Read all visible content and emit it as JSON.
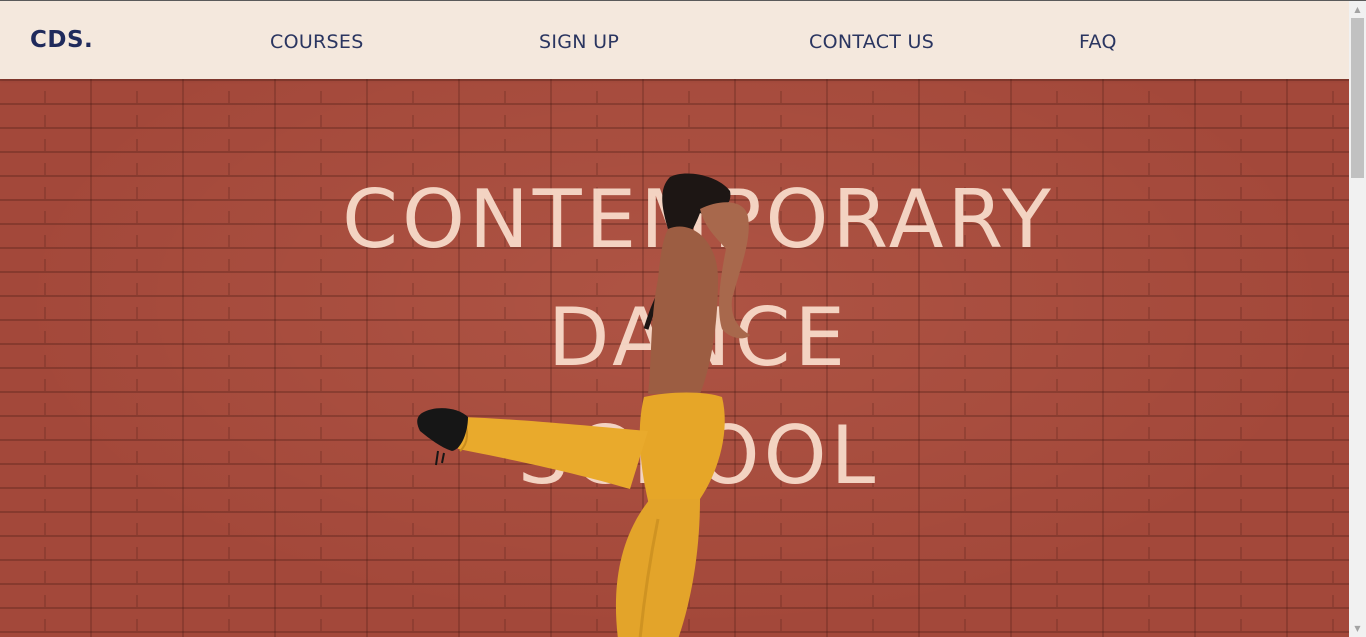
{
  "brand": {
    "logo": "CDS."
  },
  "nav": {
    "courses": "COURSES",
    "signup": "SIGN UP",
    "contact": "CONTACT US",
    "faq": "FAQ"
  },
  "hero": {
    "line1": "CONTEMPORARY",
    "line2": "DANCE",
    "line3": "SCHOOL"
  },
  "colors": {
    "navbar_bg": "#f4e8dd",
    "brand_navy": "#1f2a5c",
    "brick_red": "#a3483a",
    "outfit_yellow": "#e6a628"
  },
  "icons": {
    "scroll_up": "triangle-up-icon",
    "scroll_down": "triangle-down-icon"
  }
}
